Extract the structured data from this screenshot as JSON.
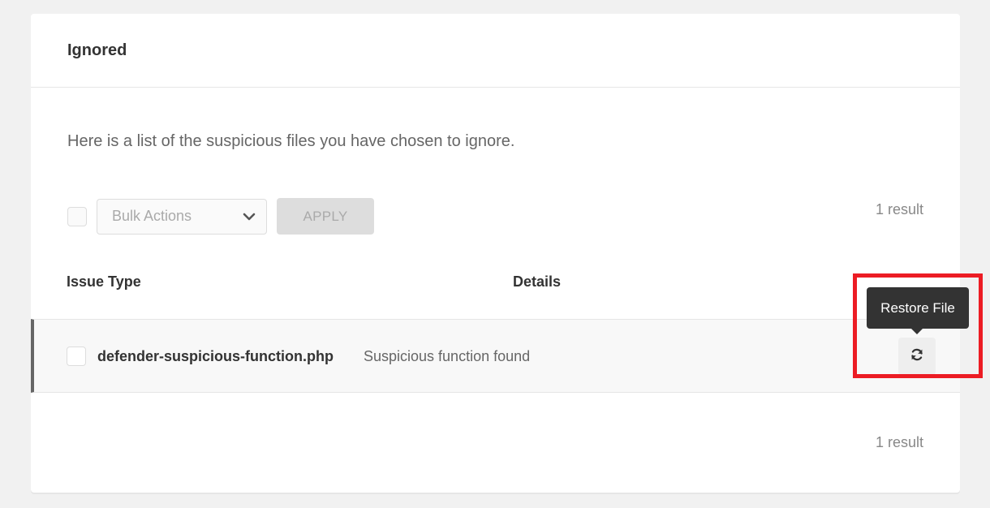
{
  "card": {
    "title": "Ignored",
    "intro": "Here is a list of the suspicious files you have chosen to ignore."
  },
  "bulk": {
    "select_label": "Bulk Actions",
    "apply_label": "APPLY",
    "result_count": "1 result"
  },
  "table": {
    "columns": [
      "Issue Type",
      "Details"
    ],
    "rows": [
      {
        "file": "defender-suspicious-function.php",
        "details": "Suspicious function found",
        "action_icon": "refresh-icon"
      }
    ]
  },
  "tooltip": {
    "label": "Restore File"
  },
  "footer": {
    "result_count": "1 result"
  },
  "colors": {
    "accent_highlight": "#ec1c24",
    "tooltip_bg": "#333333",
    "row_marker": "#666666"
  }
}
